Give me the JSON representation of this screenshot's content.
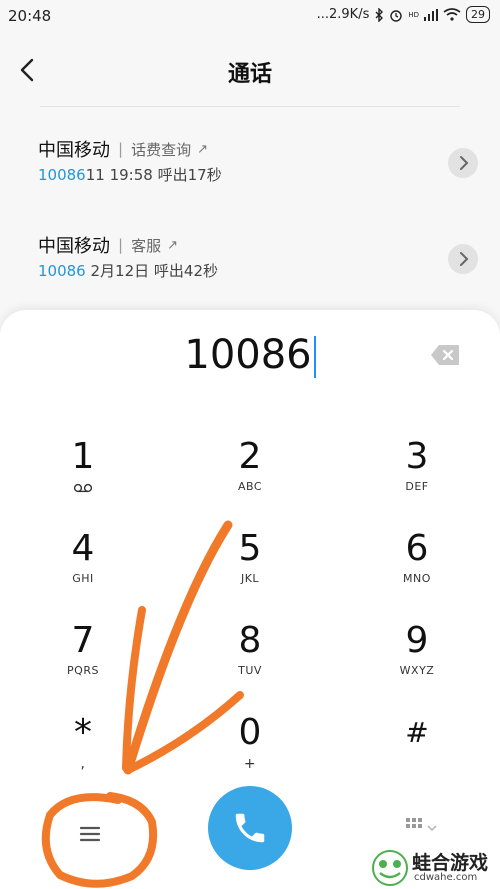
{
  "status_bar": {
    "time": "20:48",
    "net_speed": "...2.9K/s",
    "hd_label": "HD",
    "battery": "29"
  },
  "header": {
    "title": "通话"
  },
  "call_log": [
    {
      "name": "中国移动",
      "tag": "话费查询",
      "number_highlight": "10086",
      "number_rest": "11",
      "time": "19:58",
      "summary": "呼出17秒"
    },
    {
      "name": "中国移动",
      "tag": "客服",
      "number_highlight": "10086",
      "number_rest": "",
      "time": "2月12日",
      "summary": "呼出42秒"
    }
  ],
  "dialpad": {
    "entered_number": "10086",
    "keys": [
      {
        "digit": "1",
        "letters": ""
      },
      {
        "digit": "2",
        "letters": "ABC"
      },
      {
        "digit": "3",
        "letters": "DEF"
      },
      {
        "digit": "4",
        "letters": "GHI"
      },
      {
        "digit": "5",
        "letters": "JKL"
      },
      {
        "digit": "6",
        "letters": "MNO"
      },
      {
        "digit": "7",
        "letters": "PQRS"
      },
      {
        "digit": "8",
        "letters": "TUV"
      },
      {
        "digit": "9",
        "letters": "WXYZ"
      },
      {
        "digit": "*",
        "letters": ","
      },
      {
        "digit": "0",
        "letters": "+"
      },
      {
        "digit": "#",
        "letters": ""
      }
    ]
  },
  "watermark": {
    "name": "蛙合游戏",
    "url": "cdwahe.com"
  },
  "colors": {
    "accent": "#2196d9",
    "call_button": "#3aa8e6",
    "annotation": "#f07a2a"
  },
  "icons": [
    "back-arrow-icon",
    "backspace-icon",
    "voicemail-icon",
    "menu-icon",
    "phone-icon",
    "keypad-icon"
  ]
}
